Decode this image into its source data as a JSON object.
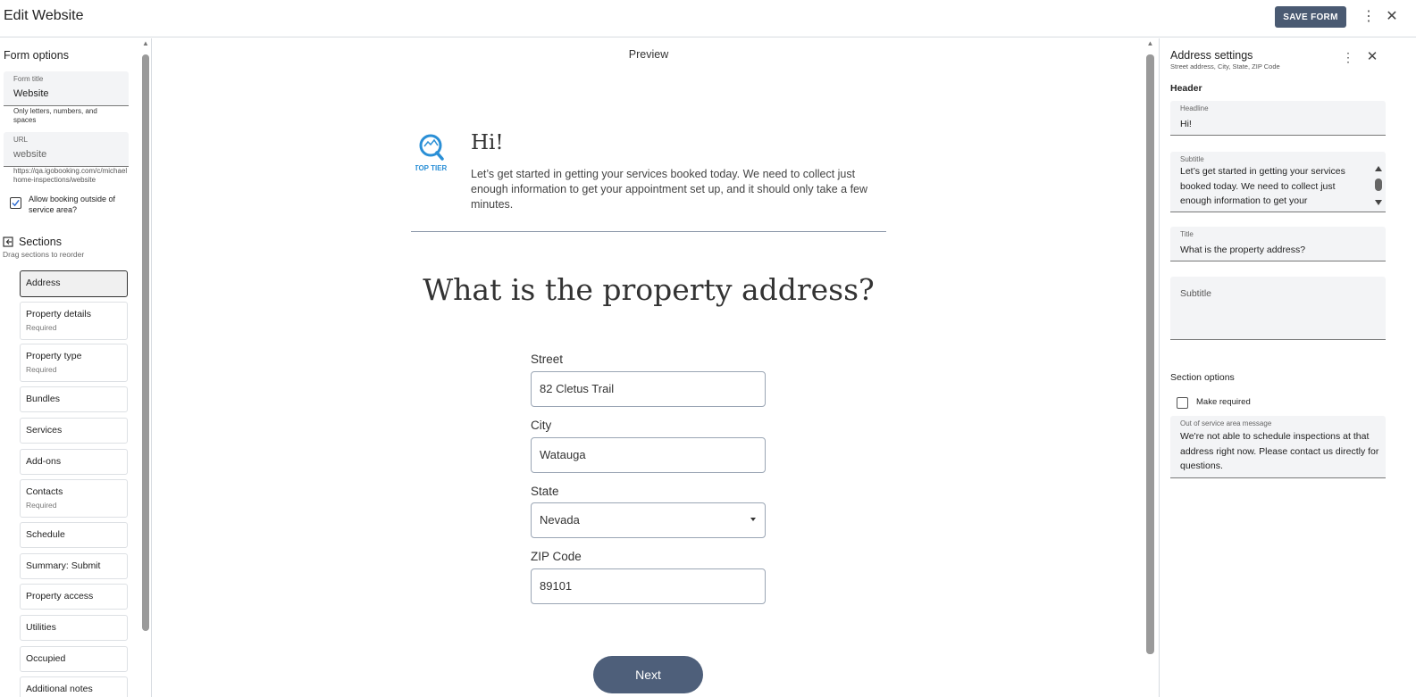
{
  "topbar": {
    "title": "Edit Website",
    "save_label": "SAVE FORM",
    "more_icon": "⋮",
    "close_icon": "✕"
  },
  "left": {
    "heading": "Form options",
    "form_title": {
      "label": "Form title",
      "value": "Website",
      "hint": "Only letters, numbers, and spaces"
    },
    "url": {
      "label": "URL",
      "value": "website",
      "hint": "https://qa.igobooking.com/c/michael home-inspections/website"
    },
    "allow_booking": {
      "label": "Allow booking outside of service area?",
      "checked": true
    },
    "sections_heading": "Sections",
    "sections_sub": "Drag sections to reorder",
    "sections": [
      {
        "name": "Address",
        "required": ""
      },
      {
        "name": "Property details",
        "required": "Required"
      },
      {
        "name": "Property type",
        "required": "Required"
      },
      {
        "name": "Bundles",
        "required": ""
      },
      {
        "name": "Services",
        "required": ""
      },
      {
        "name": "Add-ons",
        "required": ""
      },
      {
        "name": "Contacts",
        "required": "Required"
      },
      {
        "name": "Schedule",
        "required": ""
      },
      {
        "name": "Summary: Submit",
        "required": ""
      },
      {
        "name": "Property access",
        "required": ""
      },
      {
        "name": "Utilities",
        "required": ""
      },
      {
        "name": "Occupied",
        "required": ""
      },
      {
        "name": "Additional notes",
        "required": ""
      }
    ]
  },
  "preview": {
    "label": "Preview",
    "logo_text": "TOP TIER",
    "headline": "Hi!",
    "intro": "Let’s get started in getting your services booked today. We need to collect just enough information to get your appointment set up, and it should only take a few minutes.",
    "question": "What is the property address?",
    "fields": {
      "street": {
        "label": "Street",
        "value": "82 Cletus Trail"
      },
      "city": {
        "label": "City",
        "value": "Watauga"
      },
      "state": {
        "label": "State",
        "value": "Nevada"
      },
      "zip": {
        "label": "ZIP Code",
        "value": "89101"
      }
    },
    "next_label": "Next"
  },
  "right": {
    "title": "Address settings",
    "subtitle": "Street address, City, State, ZIP Code",
    "header_label": "Header",
    "headline": {
      "label": "Headline",
      "value": "Hi!"
    },
    "subtitle_field": {
      "label": "Subtitle",
      "value": "Let’s get started in getting your services booked today. We need to collect just enough information to get your"
    },
    "title_field": {
      "label": "Title",
      "value": "What is the property address?"
    },
    "subtitle2": {
      "label": "Subtitle",
      "value": ""
    },
    "section_options": "Section options",
    "make_required": {
      "label": "Make required",
      "checked": false
    },
    "out_of_service": {
      "label": "Out of service area message",
      "value": "We're not able to schedule inspections at that address right now. Please contact us directly for questions."
    }
  },
  "colors": {
    "primary_button": "#4a5a72",
    "next_button": "#4e5f7a",
    "logo_blue": "#2a8fd6"
  }
}
